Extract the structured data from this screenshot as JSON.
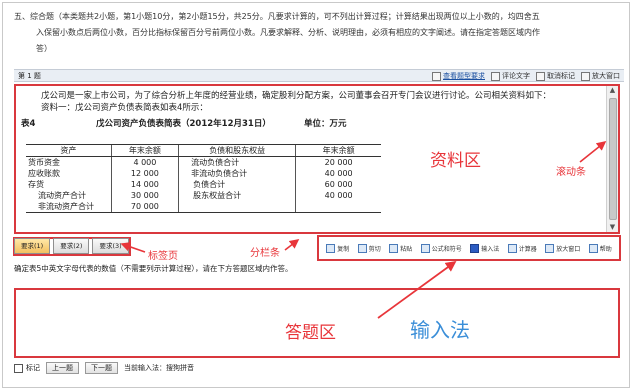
{
  "instructions": {
    "line1": "五、综合题（本类题共2小题，第1小题10分，第2小题15分，共25分。凡要求计算的，可不列出计算过程；计算结果出现两位以上小数的，均四舍五",
    "line2": "入保留小数点后两位小数，百分比指标保留百分号前两位小数。凡要求解释、分析、说明理由，必须有相应的文字阐述。请在指定答题区域内作",
    "line3": "答）"
  },
  "question_bar": {
    "number": "第 1 题",
    "tools": [
      {
        "icon": "info-icon",
        "label": "查看题型要求"
      },
      {
        "icon": "copy-icon",
        "label": "评论文字"
      },
      {
        "icon": "cancel-icon",
        "label": "取消标记"
      },
      {
        "icon": "zoom-window-icon",
        "label": "放大窗口"
      }
    ]
  },
  "material": {
    "para1": "戊公司是一家上市公司，为了综合分析上年度的经营业绩，确定股利分配方案，公司董事会召开专门会议进行讨论。公司相关资料如下：",
    "para2": "资料一：戊公司资产负债表简表如表4所示：",
    "table_label": "表4",
    "table_title": "戊公司资产负债表简表（2012年12月31日）",
    "table_unit": "单位：万元",
    "headers": [
      "资产",
      "年末余额",
      "负债和股东权益",
      "年末余额"
    ],
    "rows": [
      [
        "货币资金",
        "4 000",
        "流动负债合计",
        "20 000"
      ],
      [
        "应收账款",
        "12 000",
        "非流动负债合计",
        "40 000"
      ],
      [
        "存货",
        "14 000",
        "负债合计",
        "60 000"
      ],
      [
        "流动资产合计",
        "30 000",
        "股东权益合计",
        "40 000"
      ],
      [
        "非流动资产合计",
        "70 000",
        "",
        ""
      ]
    ]
  },
  "tabs": [
    {
      "label": "要求(1)",
      "active": true
    },
    {
      "label": "要求(2)",
      "active": false
    },
    {
      "label": "要求(3)",
      "active": false
    }
  ],
  "toolbar": [
    {
      "icon": "copy-icon",
      "label": "复制"
    },
    {
      "icon": "cut-icon",
      "label": "剪切"
    },
    {
      "icon": "paste-icon",
      "label": "粘贴"
    },
    {
      "icon": "formula-icon",
      "label": "公式和符号"
    },
    {
      "icon": "input-method-icon",
      "label": "输入法"
    },
    {
      "icon": "calculator-icon",
      "label": "计算器"
    },
    {
      "icon": "zoom-window-icon",
      "label": "放大窗口"
    },
    {
      "icon": "help-icon",
      "label": "帮助"
    }
  ],
  "question_line": "确定表5中英文字母代表的数值（不需要列示计算过程），请在下方答题区域内作答。",
  "bottom": {
    "mark": "标记",
    "prev": "上一题",
    "next": "下一题",
    "ime_status": "当前输入法：搜狗拼音"
  },
  "annotations": {
    "material_area": "资料区",
    "scrollbar": "滚动条",
    "tab_page": "标签页",
    "splitter": "分栏条",
    "answer_area": "答题区",
    "input_method": "输入法"
  },
  "colors": {
    "annotation_red": "#e8353a",
    "annotation_blue": "#3a8ed8"
  }
}
